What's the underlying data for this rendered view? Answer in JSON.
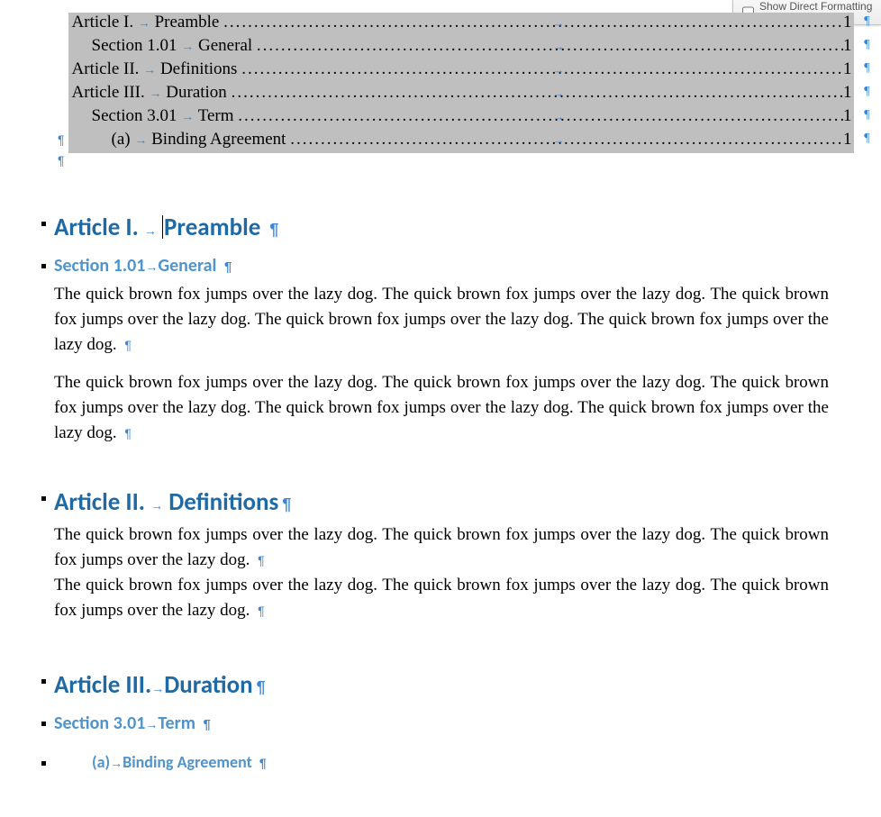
{
  "panel": {
    "checkbox_label": "Show Direct Formatting Guid"
  },
  "marks": {
    "pilcrow": "¶",
    "tab": "→"
  },
  "toc": [
    {
      "level": 1,
      "num": "Article I.",
      "title": "Preamble",
      "page": "1"
    },
    {
      "level": 2,
      "num": "Section 1.01",
      "title": "General",
      "page": "1"
    },
    {
      "level": 1,
      "num": "Article II.",
      "title": "Definitions",
      "page": "1"
    },
    {
      "level": 1,
      "num": "Article III.",
      "title": "Duration",
      "page": "1"
    },
    {
      "level": 2,
      "num": "Section 3.01",
      "title": "Term",
      "page": "1"
    },
    {
      "level": 3,
      "num": "(a)",
      "title": "Binding Agreement",
      "page": "1"
    }
  ],
  "headings": {
    "h1a_num": "Article I.",
    "h1a_title": "Preamble",
    "h2a_num": "Section 1.01",
    "h2a_title": "General",
    "h1b_num": "Article II.",
    "h1b_title": "Definitions",
    "h1c_num": "Article III.",
    "h1c_title": "Duration",
    "h2b_num": "Section 3.01",
    "h2b_title": "Term",
    "h3a_num": "(a)",
    "h3a_title": "Binding Agreement"
  },
  "body": {
    "sentence": "The quick brown fox jumps over the lazy dog.",
    "para5": "The quick brown fox jumps over the lazy dog.  The quick brown fox jumps over the lazy dog. The quick brown fox jumps over the lazy dog.  The quick brown fox jumps over the lazy dog. The quick brown fox jumps over the lazy dog.",
    "para3": "The quick brown fox jumps over the lazy dog.  The quick brown fox jumps over the lazy dog. The quick brown fox jumps over the lazy dog."
  }
}
